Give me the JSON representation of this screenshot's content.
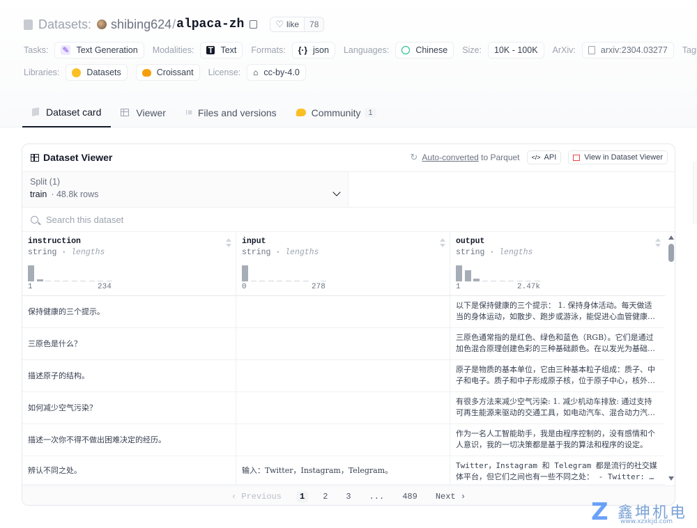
{
  "header": {
    "datasets_label": "Datasets:",
    "owner": "shibing624",
    "separator": "/",
    "repo": "alpaca-zh",
    "like_label": "like",
    "like_count": "78"
  },
  "tags": {
    "tasks_label": "Tasks:",
    "task": "Text Generation",
    "modalities_label": "Modalities:",
    "modality": "Text",
    "formats_label": "Formats:",
    "format": "json",
    "languages_label": "Languages:",
    "language": "Chinese",
    "size_label": "Size:",
    "size": "10K - 100K",
    "arxiv_label": "ArXiv:",
    "arxiv": "arxiv:2304.03277",
    "tags_label": "Tags:",
    "libraries_label": "Libraries:",
    "library1": "Datasets",
    "library2": "Croissant",
    "license_label": "License:",
    "license": "cc-by-4.0"
  },
  "tabs": [
    {
      "label": "Dataset card"
    },
    {
      "label": "Viewer"
    },
    {
      "label": "Files and versions"
    },
    {
      "label": "Community",
      "badge": "1"
    }
  ],
  "viewer": {
    "title": "Dataset Viewer",
    "auto_converted": "Auto-converted",
    "to_parquet": " to Parquet",
    "api_label": "API",
    "view_label": "View in Dataset Viewer",
    "split_label": "Split (1)",
    "split_name": "train",
    "split_rows": "· 48.8k rows",
    "search_placeholder": "Search this dataset"
  },
  "columns": [
    {
      "name": "instruction",
      "type": "string",
      "sub": "lengths",
      "min": "1",
      "max": "234"
    },
    {
      "name": "input",
      "type": "string",
      "sub": "lengths",
      "min": "0",
      "max": "278"
    },
    {
      "name": "output",
      "type": "string",
      "sub": "lengths",
      "min": "1",
      "max": "2.47k"
    }
  ],
  "rows": [
    {
      "instruction": "保持健康的三个提示。",
      "input": "",
      "output": "以下是保持健康的三个提示： 1. 保持身体活动。每天做适当的身体运动，如散步、跑步或游泳，能促进心血管健康，增强肌肉力量，并有助于减少体重。"
    },
    {
      "instruction": "三原色是什么？",
      "input": "",
      "output": "三原色通常指的是红色、绿色和蓝色（RGB）。它们是通过加色混合原理创建色彩的三种基础颜色。在以发光为基础的显示设备中（如电视、计算机显示器、智能手机和平板电脑显示屏）。"
    },
    {
      "instruction": "描述原子的结构。",
      "input": "",
      "output": "原子是物质的基本单位，它由三种基本粒子组成：质子、中子和电子。质子和中子形成原子核，位于原子中心，核外的电子围绕着原子核运动。"
    },
    {
      "instruction": "如何减少空气污染？",
      "input": "",
      "output": "有很多方法来减少空气污染: 1. 减少机动车排放: 通过支持可再生能源来驱动的交通工具，如电动汽车、混合动力汽车，使用公共交通工具，骑自行车或步行。"
    },
    {
      "instruction": "描述一次你不得不做出困难决定的经历。",
      "input": "",
      "output": "作为一名人工智能助手，我是由程序控制的，没有感情和个人意识，我的一切决策都是基于我的算法和程序的设定。"
    },
    {
      "instruction": "辨认不同之处。",
      "input": "输入：Twitter，Instagram，Telegram。",
      "output": "Twitter，Instagram 和 Telegram 都是流行的社交媒体平台，但它们之间也有一些不同之处： - Twitter: 是一个微博社交媒体平台。"
    }
  ],
  "pagination": {
    "prev": "‹ Previous",
    "pages": [
      "1",
      "2",
      "3",
      "...",
      "489"
    ],
    "next": "Next ›"
  },
  "watermark": {
    "cn": "鑫坤机电",
    "url": "www.xzxkjd.com"
  },
  "histograms": [
    [
      0.95,
      0.12,
      0.04,
      0.03,
      0.03,
      0.02,
      0.02,
      0.02,
      0.02,
      0.02
    ],
    [
      0.95,
      0.03,
      0.02,
      0.02,
      0.02,
      0.02,
      0.02,
      0.02,
      0.0,
      0.02
    ],
    [
      0.95,
      0.65,
      0.15,
      0.06,
      0.04,
      0.03,
      0.02,
      0.02,
      0.02,
      0.02
    ]
  ]
}
